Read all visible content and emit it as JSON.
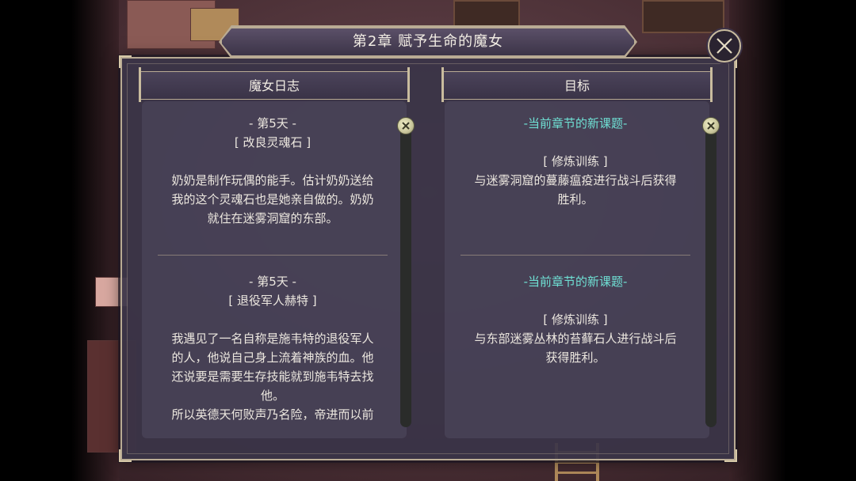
{
  "dialog": {
    "title": "第2章  赋予生命的魔女"
  },
  "close_button": {
    "icon": "close-icon"
  },
  "journal": {
    "header": "魔女日志",
    "entries": [
      {
        "day": "- 第5天 -",
        "subject": "[ 改良灵魂石 ]",
        "body": [
          "奶奶是制作玩偶的能手。估计奶奶送给",
          "我的这个灵魂石也是她亲自做的。奶奶",
          "就住在迷雾洞窟的东部。"
        ]
      },
      {
        "day": "- 第5天 -",
        "subject": "[ 退役军人赫特 ]",
        "body": [
          "我遇见了一名自称是施韦特的退役军人",
          "的人，他说自己身上流着神族的血。他",
          "还说要是需要生存技能就到施韦特去找",
          "他。",
          "所以英德天何败声乃名险，帝进而以前"
        ]
      }
    ]
  },
  "objectives": {
    "header": "目标",
    "entries": [
      {
        "label": "-当前章节的新课题-",
        "subject": "[ 修炼训练 ]",
        "body": [
          "与迷雾洞窟的蔓藤瘟疫进行战斗后获得",
          "胜利。"
        ]
      },
      {
        "label": "-当前章节的新课题-",
        "subject": "[ 修炼训练 ]",
        "body": [
          "与东部迷雾丛林的苔藓石人进行战斗后",
          "获得胜利。"
        ]
      }
    ]
  },
  "colors": {
    "panel": "#3a3448",
    "border": "#b9ab94",
    "quest_accent": "#6fe0d4",
    "text": "#ece7df"
  }
}
